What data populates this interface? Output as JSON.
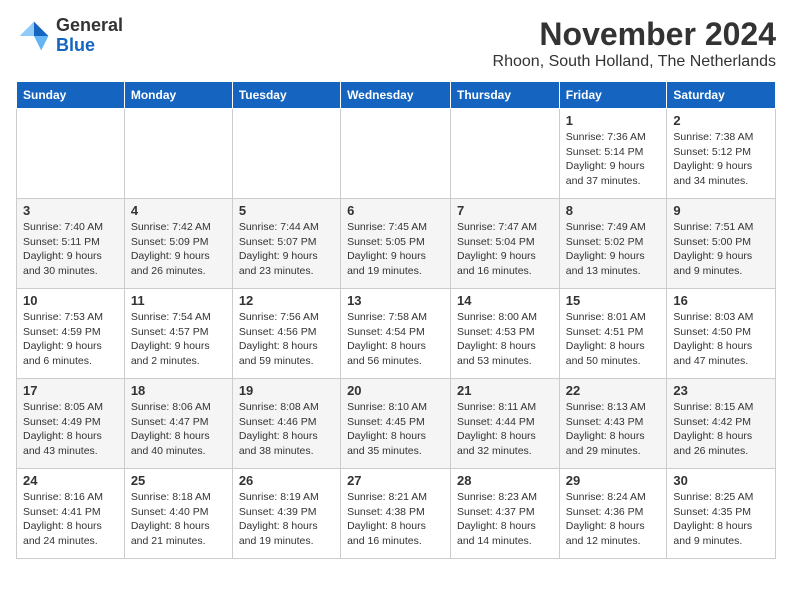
{
  "header": {
    "logo_general": "General",
    "logo_blue": "Blue",
    "month_title": "November 2024",
    "location": "Rhoon, South Holland, The Netherlands"
  },
  "days_of_week": [
    "Sunday",
    "Monday",
    "Tuesday",
    "Wednesday",
    "Thursday",
    "Friday",
    "Saturday"
  ],
  "weeks": [
    [
      {
        "day": "",
        "info": ""
      },
      {
        "day": "",
        "info": ""
      },
      {
        "day": "",
        "info": ""
      },
      {
        "day": "",
        "info": ""
      },
      {
        "day": "",
        "info": ""
      },
      {
        "day": "1",
        "info": "Sunrise: 7:36 AM\nSunset: 5:14 PM\nDaylight: 9 hours and 37 minutes."
      },
      {
        "day": "2",
        "info": "Sunrise: 7:38 AM\nSunset: 5:12 PM\nDaylight: 9 hours and 34 minutes."
      }
    ],
    [
      {
        "day": "3",
        "info": "Sunrise: 7:40 AM\nSunset: 5:11 PM\nDaylight: 9 hours and 30 minutes."
      },
      {
        "day": "4",
        "info": "Sunrise: 7:42 AM\nSunset: 5:09 PM\nDaylight: 9 hours and 26 minutes."
      },
      {
        "day": "5",
        "info": "Sunrise: 7:44 AM\nSunset: 5:07 PM\nDaylight: 9 hours and 23 minutes."
      },
      {
        "day": "6",
        "info": "Sunrise: 7:45 AM\nSunset: 5:05 PM\nDaylight: 9 hours and 19 minutes."
      },
      {
        "day": "7",
        "info": "Sunrise: 7:47 AM\nSunset: 5:04 PM\nDaylight: 9 hours and 16 minutes."
      },
      {
        "day": "8",
        "info": "Sunrise: 7:49 AM\nSunset: 5:02 PM\nDaylight: 9 hours and 13 minutes."
      },
      {
        "day": "9",
        "info": "Sunrise: 7:51 AM\nSunset: 5:00 PM\nDaylight: 9 hours and 9 minutes."
      }
    ],
    [
      {
        "day": "10",
        "info": "Sunrise: 7:53 AM\nSunset: 4:59 PM\nDaylight: 9 hours and 6 minutes."
      },
      {
        "day": "11",
        "info": "Sunrise: 7:54 AM\nSunset: 4:57 PM\nDaylight: 9 hours and 2 minutes."
      },
      {
        "day": "12",
        "info": "Sunrise: 7:56 AM\nSunset: 4:56 PM\nDaylight: 8 hours and 59 minutes."
      },
      {
        "day": "13",
        "info": "Sunrise: 7:58 AM\nSunset: 4:54 PM\nDaylight: 8 hours and 56 minutes."
      },
      {
        "day": "14",
        "info": "Sunrise: 8:00 AM\nSunset: 4:53 PM\nDaylight: 8 hours and 53 minutes."
      },
      {
        "day": "15",
        "info": "Sunrise: 8:01 AM\nSunset: 4:51 PM\nDaylight: 8 hours and 50 minutes."
      },
      {
        "day": "16",
        "info": "Sunrise: 8:03 AM\nSunset: 4:50 PM\nDaylight: 8 hours and 47 minutes."
      }
    ],
    [
      {
        "day": "17",
        "info": "Sunrise: 8:05 AM\nSunset: 4:49 PM\nDaylight: 8 hours and 43 minutes."
      },
      {
        "day": "18",
        "info": "Sunrise: 8:06 AM\nSunset: 4:47 PM\nDaylight: 8 hours and 40 minutes."
      },
      {
        "day": "19",
        "info": "Sunrise: 8:08 AM\nSunset: 4:46 PM\nDaylight: 8 hours and 38 minutes."
      },
      {
        "day": "20",
        "info": "Sunrise: 8:10 AM\nSunset: 4:45 PM\nDaylight: 8 hours and 35 minutes."
      },
      {
        "day": "21",
        "info": "Sunrise: 8:11 AM\nSunset: 4:44 PM\nDaylight: 8 hours and 32 minutes."
      },
      {
        "day": "22",
        "info": "Sunrise: 8:13 AM\nSunset: 4:43 PM\nDaylight: 8 hours and 29 minutes."
      },
      {
        "day": "23",
        "info": "Sunrise: 8:15 AM\nSunset: 4:42 PM\nDaylight: 8 hours and 26 minutes."
      }
    ],
    [
      {
        "day": "24",
        "info": "Sunrise: 8:16 AM\nSunset: 4:41 PM\nDaylight: 8 hours and 24 minutes."
      },
      {
        "day": "25",
        "info": "Sunrise: 8:18 AM\nSunset: 4:40 PM\nDaylight: 8 hours and 21 minutes."
      },
      {
        "day": "26",
        "info": "Sunrise: 8:19 AM\nSunset: 4:39 PM\nDaylight: 8 hours and 19 minutes."
      },
      {
        "day": "27",
        "info": "Sunrise: 8:21 AM\nSunset: 4:38 PM\nDaylight: 8 hours and 16 minutes."
      },
      {
        "day": "28",
        "info": "Sunrise: 8:23 AM\nSunset: 4:37 PM\nDaylight: 8 hours and 14 minutes."
      },
      {
        "day": "29",
        "info": "Sunrise: 8:24 AM\nSunset: 4:36 PM\nDaylight: 8 hours and 12 minutes."
      },
      {
        "day": "30",
        "info": "Sunrise: 8:25 AM\nSunset: 4:35 PM\nDaylight: 8 hours and 9 minutes."
      }
    ]
  ]
}
